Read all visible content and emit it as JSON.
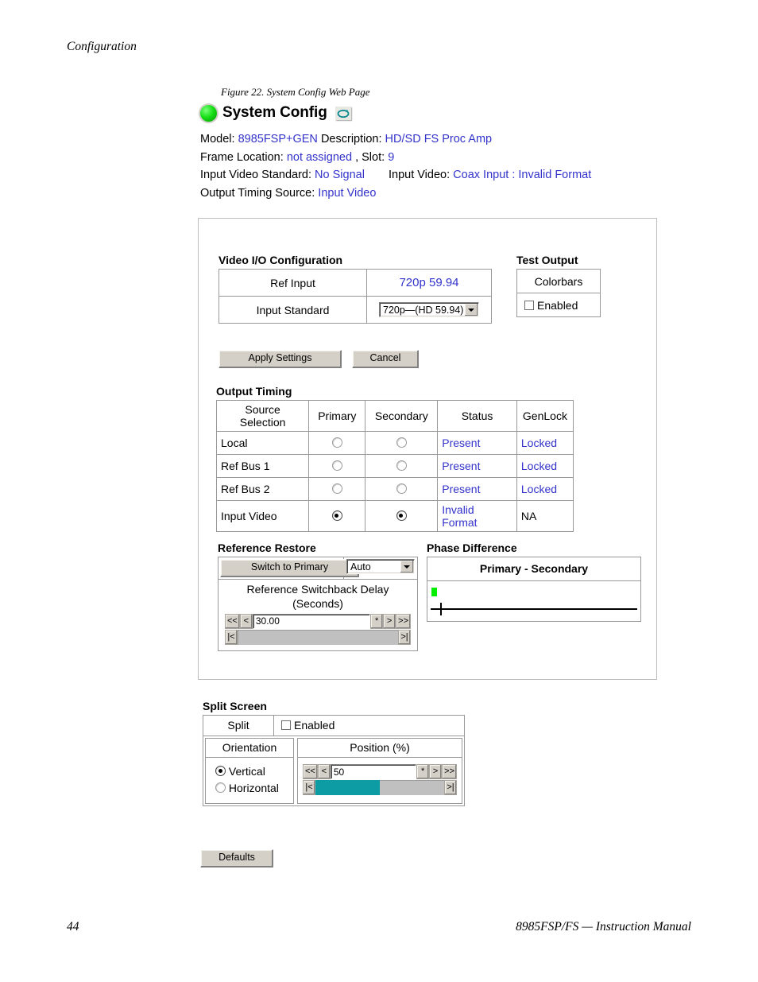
{
  "document": {
    "running_head": "Configuration",
    "figure_caption": "Figure 22.  System Config Web Page",
    "page_number": "44",
    "footer_right": "8985FSP/FS — Instruction Manual"
  },
  "webpage": {
    "title": "System Config",
    "status_led_color": "#18e018",
    "refresh_icon_color": "#0d8a92",
    "info": {
      "model_label": "Model:",
      "model_value": "8985FSP+GEN",
      "description_label": "Description:",
      "description_value": "HD/SD FS Proc Amp",
      "frame_location_label": "Frame Location:",
      "frame_location_value": "not assigned",
      "slot_label": ", Slot:",
      "slot_value": "9",
      "input_video_standard_label": "Input Video Standard:",
      "input_video_standard_value": "No Signal",
      "input_video_label": "Input Video:",
      "input_video_value": "Coax Input : Invalid Format",
      "output_timing_source_label": "Output Timing Source:",
      "output_timing_source_value": "Input Video"
    },
    "link_color": "#3333cc"
  },
  "video_io": {
    "title": "Video I/O Configuration",
    "rows": [
      {
        "label": "Ref Input",
        "value": "720p 59.94"
      },
      {
        "label": "Input Standard",
        "value": "720p—(HD 59.94)"
      }
    ],
    "apply_label": "Apply Settings",
    "cancel_label": "Cancel"
  },
  "test_output": {
    "title": "Test Output",
    "colorbars_label": "Colorbars",
    "enabled_label": "Enabled",
    "enabled_checked": false
  },
  "output_timing": {
    "title": "Output Timing",
    "headers": [
      "Source Selection",
      "Primary",
      "Secondary",
      "Status",
      "GenLock"
    ],
    "rows": [
      {
        "source": "Local",
        "primary": false,
        "secondary": false,
        "status": "Present",
        "genlock": "Locked",
        "status_link": true,
        "genlock_link": true
      },
      {
        "source": "Ref Bus 1",
        "primary": false,
        "secondary": false,
        "status": "Present",
        "genlock": "Locked",
        "status_link": true,
        "genlock_link": true
      },
      {
        "source": "Ref Bus 2",
        "primary": false,
        "secondary": false,
        "status": "Present",
        "genlock": "Locked",
        "status_link": true,
        "genlock_link": true
      },
      {
        "source": "Input Video",
        "primary": true,
        "secondary": true,
        "status": "Invalid Format",
        "genlock": "NA",
        "status_link": true,
        "genlock_link": false
      }
    ]
  },
  "reference_restore": {
    "title": "Reference Restore",
    "switch_button_label": "Switch to Primary",
    "mode_value": "Auto",
    "delay_caption_line1": "Reference Switchback Delay",
    "delay_caption_line2": "(Seconds)",
    "delay_value": "30.00",
    "slider_fill_percent": 0,
    "spin_buttons": [
      "<<",
      "<",
      "*",
      ">",
      ">>"
    ],
    "track_buttons": [
      "|<",
      ">|"
    ]
  },
  "phase_difference": {
    "title": "Phase Difference",
    "header": "Primary - Secondary",
    "marker_color": "#00ee00"
  },
  "split_screen": {
    "title": "Split Screen",
    "split_label": "Split",
    "enabled_label": "Enabled",
    "enabled_checked": false,
    "orientation_label": "Orientation",
    "orientation_options": [
      {
        "label": "Vertical",
        "selected": true
      },
      {
        "label": "Horizontal",
        "selected": false
      }
    ],
    "position_label": "Position (%)",
    "position_value": "50",
    "slider_fill_percent": 50,
    "slider_fill_color": "#0d9ba4",
    "spin_buttons": [
      "<<",
      "<",
      "*",
      ">",
      ">>"
    ],
    "track_buttons": [
      "|<",
      ">|"
    ]
  },
  "defaults": {
    "label": "Defaults"
  }
}
